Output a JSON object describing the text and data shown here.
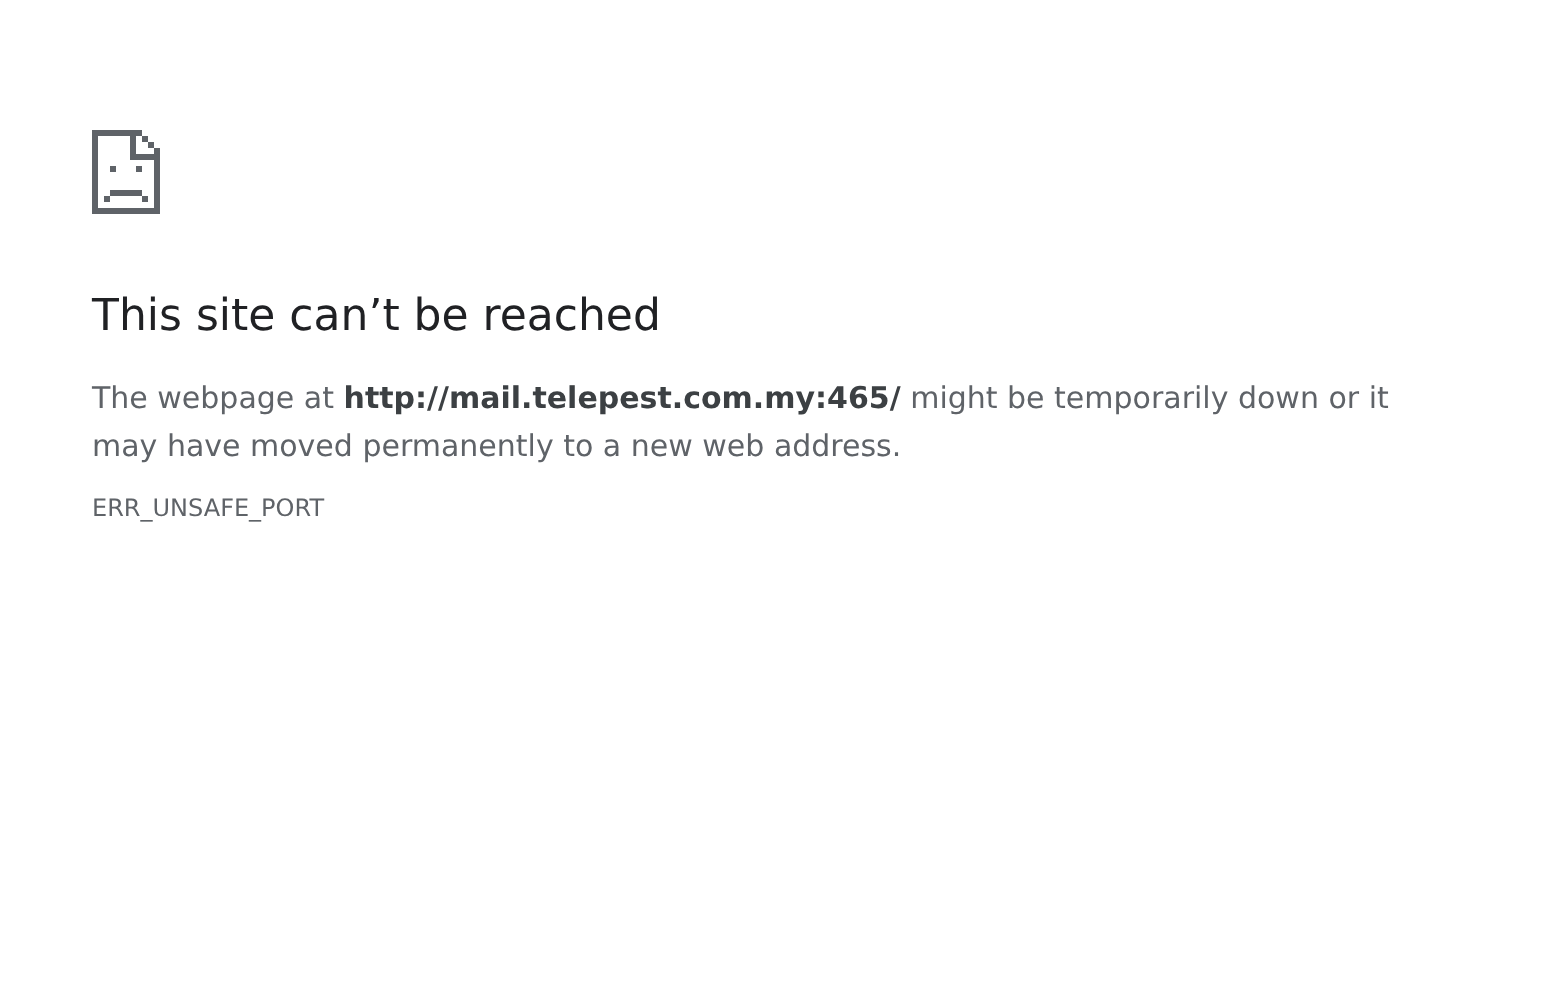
{
  "heading": "This site can’t be reached",
  "message": "The webpage at **http://mail.telepest.com.my:465/** might be temporarily down or it may have moved permanently to a new web address.",
  "error_code": "ERR_UNSAFE_PORT"
}
